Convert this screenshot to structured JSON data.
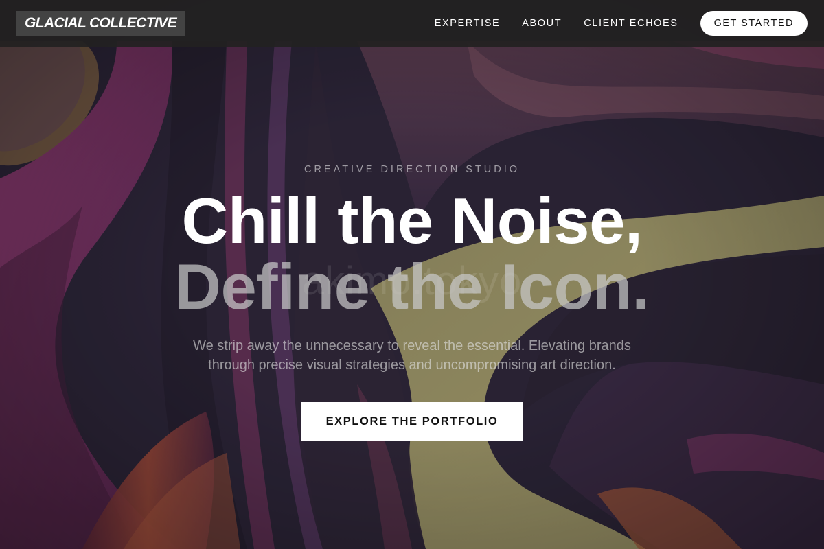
{
  "nav": {
    "logo": "GLACIAL COLLECTIVE",
    "links": [
      "EXPERTISE",
      "ABOUT",
      "CLIENT ECHOES"
    ],
    "cta": "GET STARTED"
  },
  "hero": {
    "eyebrow": "CREATIVE DIRECTION STUDIO",
    "headline_line1": "Chill the Noise,",
    "headline_line2": "Define the Icon.",
    "watermark": "akimo.tokyo",
    "subtext": "We strip away the unnecessary to reveal the essential. Elevating brands through precise visual strategies and uncompromising art direction.",
    "cta": "EXPLORE THE PORTFOLIO"
  },
  "colors": {
    "nav_bg": "#222121",
    "bg_base": "#2b2538",
    "accent_magenta": "#8a3a6e",
    "accent_olive": "#b6b070",
    "accent_rust": "#a04a3a"
  }
}
